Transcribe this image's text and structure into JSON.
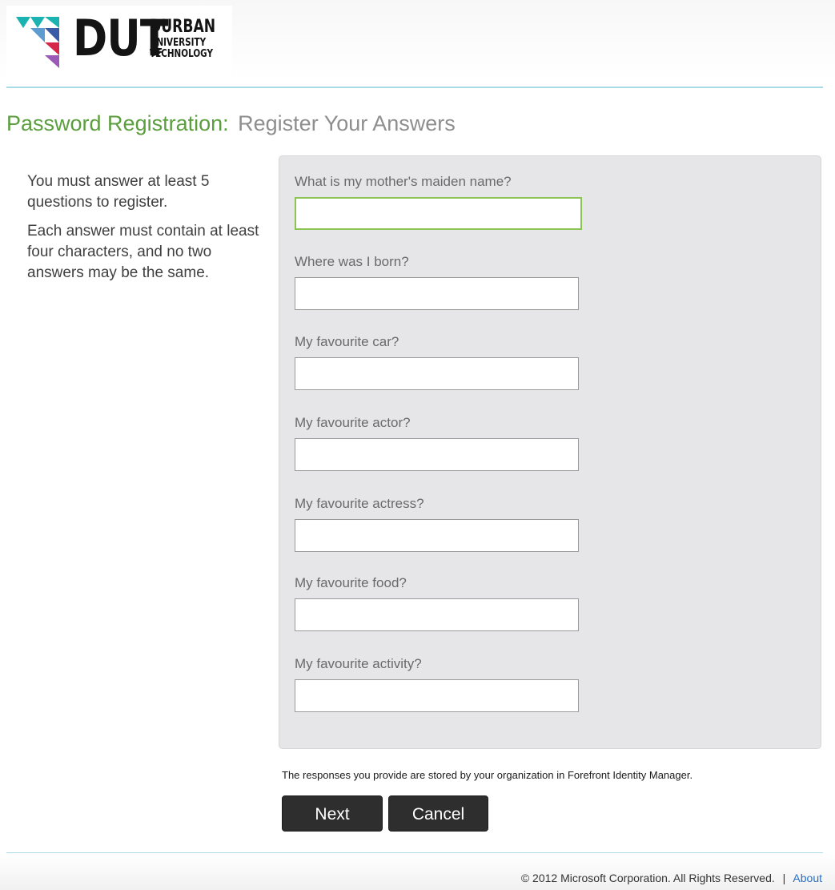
{
  "logo": {
    "name": "dut-logo",
    "wordmark": "DUT",
    "line1": "DURBAN",
    "line2": "UNIVERSITY OF",
    "line3": "TECHNOLOGY"
  },
  "title": {
    "main": "Password Registration:",
    "sub": "Register Your Answers"
  },
  "instructions": {
    "p1": "You must answer at least 5 questions to register.",
    "p2": "Each answer must contain at least four characters, and no two answers may be the same."
  },
  "questions": [
    {
      "label": "What is my mother's maiden name?",
      "value": "",
      "focused": true
    },
    {
      "label": "Where was I born?",
      "value": ""
    },
    {
      "label": "My favourite car?",
      "value": ""
    },
    {
      "label": "My favourite actor?",
      "value": ""
    },
    {
      "label": "My favourite actress?",
      "value": ""
    },
    {
      "label": "My favourite food?",
      "value": ""
    },
    {
      "label": "My favourite activity?",
      "value": ""
    }
  ],
  "storage_note": "The responses you provide are stored by your organization in Forefront Identity Manager.",
  "buttons": {
    "next": "Next",
    "cancel": "Cancel"
  },
  "footer": {
    "copyright": "© 2012 Microsoft Corporation. All Rights Reserved.",
    "separator": "|",
    "about": "About"
  },
  "colors": {
    "title_green": "#5a9e3e",
    "title_gray": "#8e8e8e",
    "rule_blue": "#a8dbe6",
    "focus_green": "#8cc355",
    "button_dark": "#2e2e2e",
    "link_blue": "#2a6fc2"
  }
}
